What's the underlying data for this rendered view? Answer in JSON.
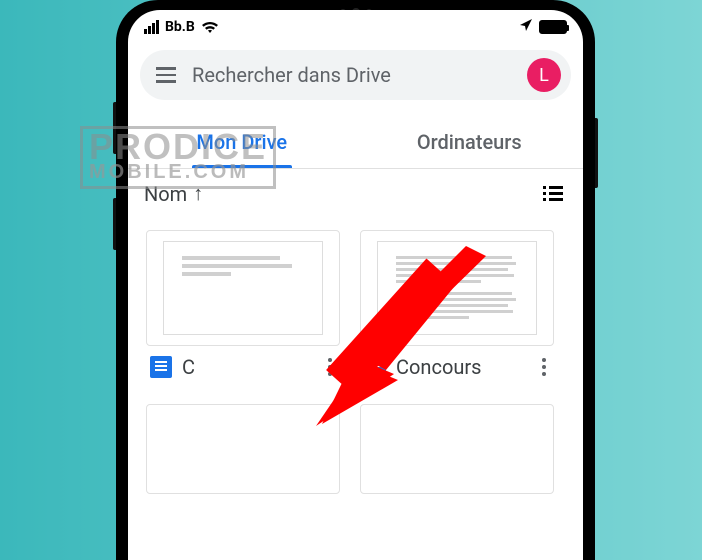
{
  "status": {
    "carrier": "Bb.B"
  },
  "search": {
    "placeholder": "Rechercher dans Drive",
    "avatar_letter": "L"
  },
  "tabs": {
    "my_drive": "Mon Drive",
    "computers": "Ordinateurs"
  },
  "sort": {
    "label": "Nom",
    "direction": "↑"
  },
  "files": [
    {
      "name": "C"
    },
    {
      "name": "Concours"
    }
  ],
  "watermark": {
    "line1": "PRODICE",
    "line2": "MOBILE.COM"
  }
}
